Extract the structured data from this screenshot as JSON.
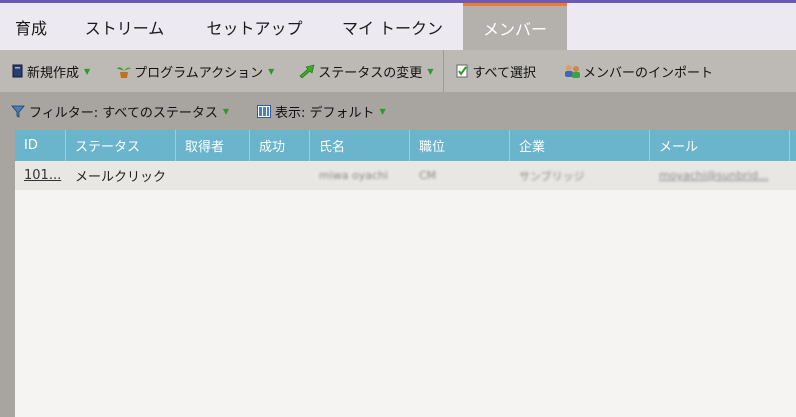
{
  "tabs": [
    {
      "label": "育成"
    },
    {
      "label": "ストリーム"
    },
    {
      "label": "セットアップ"
    },
    {
      "label": "マイ トークン"
    },
    {
      "label": "メンバー",
      "active": true
    }
  ],
  "toolbar": {
    "new_label": "新規作成",
    "program_action_label": "プログラムアクション",
    "change_status_label": "ステータスの変更",
    "select_all_label": "すべて選択",
    "import_members_label": "メンバーのインポート"
  },
  "filterbar": {
    "filter_label": "フィルター: すべてのステータス",
    "view_label": "表示: デフォルト"
  },
  "table": {
    "columns": [
      "ID",
      "ステータス",
      "取得者",
      "成功",
      "氏名",
      "職位",
      "企業",
      "メール"
    ],
    "rows": [
      {
        "id": "101...",
        "status": "メールクリック",
        "acquired_by": "",
        "success": "",
        "name": "miwa oyachi",
        "title": "CM",
        "company": "サンブリッジ",
        "email": "moyachi@sunbrid..."
      }
    ]
  },
  "colors": {
    "accent_orange": "#f07a2e",
    "header_blue": "#6ab4cc",
    "top_line_purple": "#6a5bb5"
  },
  "icons": [
    "new-document-icon",
    "program-plant-icon",
    "status-arrow-icon",
    "checklist-icon",
    "member-import-icon",
    "filter-funnel-icon",
    "view-columns-icon",
    "dropdown-arrow-icon"
  ]
}
